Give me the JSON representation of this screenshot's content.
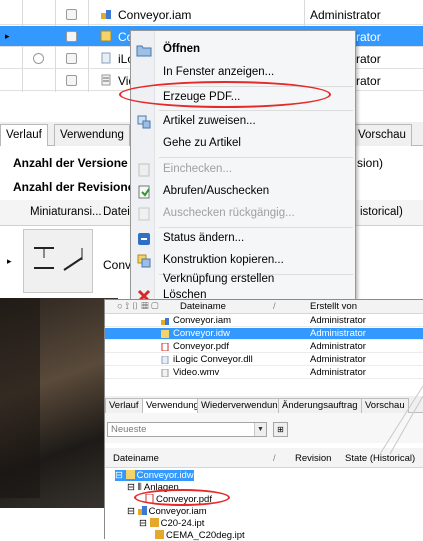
{
  "background": {
    "files": [
      {
        "name": "Conveyor.iam",
        "creator": "Administrator",
        "selected": false
      },
      {
        "name": "Conveyor.idw",
        "creator": "Administrator",
        "selected": true
      },
      {
        "name": "iLo",
        "creator": "Administrator",
        "selected": false
      },
      {
        "name": "Vid",
        "creator": "Administrator",
        "selected": false
      }
    ],
    "tabs": [
      "Verlauf",
      "Verwendung",
      "Vorschau"
    ],
    "info": {
      "versions_label": "Anzahl der Versione",
      "revisions_label": "Anzahl der Revisione",
      "version_suffix": "sion)"
    },
    "columns": {
      "thumbnail": "Miniaturansi...",
      "file": "Datei",
      "state": "istorical)"
    },
    "thumb_row_label": "Conve"
  },
  "context_menu": {
    "items": [
      {
        "label": "Öffnen",
        "bold": true,
        "disabled": false,
        "icon": "open-folder-icon"
      },
      {
        "label": "In Fenster anzeigen...",
        "bold": false,
        "disabled": false,
        "icon": ""
      },
      {
        "label": "Erzeuge PDF...",
        "bold": false,
        "disabled": false,
        "icon": ""
      },
      {
        "label": "Artikel zuweisen...",
        "bold": false,
        "disabled": false,
        "icon": "assign-item-icon"
      },
      {
        "label": "Gehe zu Artikel",
        "bold": false,
        "disabled": false,
        "icon": ""
      },
      {
        "label": "Einchecken...",
        "bold": false,
        "disabled": true,
        "icon": "checkin-icon"
      },
      {
        "label": "Abrufen/Auschecken",
        "bold": false,
        "disabled": false,
        "icon": "checkout-icon"
      },
      {
        "label": "Auschecken rückgängig...",
        "bold": false,
        "disabled": true,
        "icon": "undo-checkout-icon"
      },
      {
        "label": "Status ändern...",
        "bold": false,
        "disabled": false,
        "icon": "status-icon"
      },
      {
        "label": "Konstruktion kopieren...",
        "bold": false,
        "disabled": false,
        "icon": "copy-design-icon"
      },
      {
        "label": "Verknüpfung erstellen",
        "bold": false,
        "disabled": false,
        "icon": ""
      },
      {
        "label": "Löschen",
        "bold": false,
        "disabled": false,
        "icon": "delete-x-icon"
      }
    ]
  },
  "inset": {
    "header": {
      "filename": "Dateiname",
      "created_by": "Erstellt von"
    },
    "files": [
      {
        "name": "Conveyor.iam",
        "creator": "Administrator",
        "selected": false
      },
      {
        "name": "Conveyor.idw",
        "creator": "Administrator",
        "selected": true
      },
      {
        "name": "Conveyor.pdf",
        "creator": "Administrator",
        "selected": false
      },
      {
        "name": "iLogic Conveyor.dll",
        "creator": "Administrator",
        "selected": false
      },
      {
        "name": "Video.wmv",
        "creator": "Administrator",
        "selected": false
      }
    ],
    "tabs": [
      "Verlauf",
      "Verwendung",
      "Wiederverwendung",
      "Änderungsauftrag",
      "Vorschau"
    ],
    "filter_value": "Neueste",
    "columns": {
      "filename": "Dateiname",
      "revision": "Revision",
      "state": "State (Historical)"
    },
    "tree": [
      {
        "label": "Conveyor.idw",
        "level": 0,
        "selected": true
      },
      {
        "label": "Anlagen",
        "level": 1,
        "selected": false
      },
      {
        "label": "Conveyor.pdf",
        "level": 2,
        "selected": false
      },
      {
        "label": "Conveyor.iam",
        "level": 1,
        "selected": false
      },
      {
        "label": "C20-24.ipt",
        "level": 2,
        "selected": false
      },
      {
        "label": "CEMA_C20deg.ipt",
        "level": 3,
        "selected": false
      }
    ]
  },
  "colors": {
    "selection": "#3399ff",
    "highlight_ellipse": "#e52a2a"
  }
}
